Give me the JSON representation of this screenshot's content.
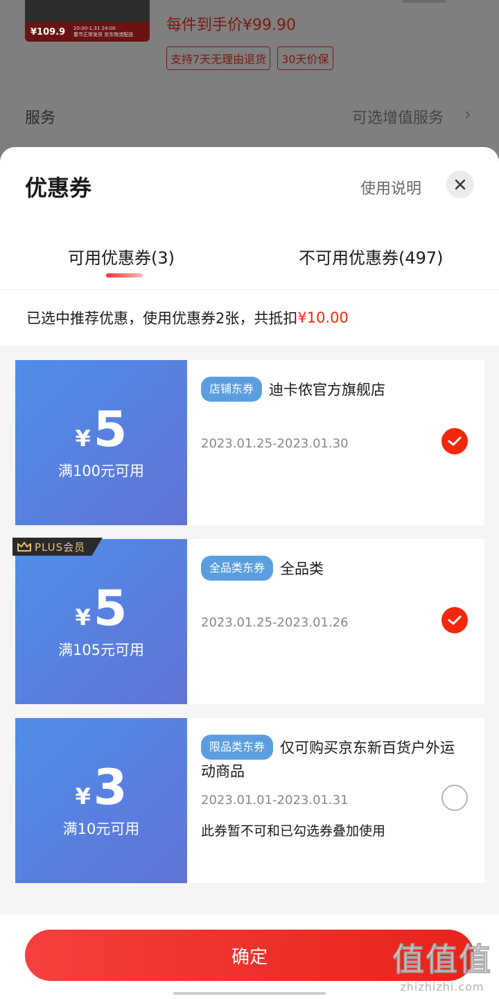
{
  "background": {
    "thumb_price": "¥109.9",
    "thumb_promo_time": "20:00-1.31 24:00",
    "thumb_promo_text": "春节正常发货 京东物流配送",
    "price_line": "每件到手价¥99.90",
    "tags": [
      "支持7天无理由退货",
      "30天价保"
    ],
    "service_label": "服务",
    "service_value": "可选增值服务",
    "service_arrow": "›"
  },
  "sheet": {
    "title": "优惠券",
    "usage_link": "使用说明",
    "tabs": [
      {
        "label": "可用优惠券(3)",
        "active": true
      },
      {
        "label": "不可用优惠券(497)",
        "active": false
      }
    ],
    "summary_text": "已选中推荐优惠，使用优惠券2张，共抵扣",
    "summary_amount": "¥10.00"
  },
  "coupons": [
    {
      "currency": "¥",
      "amount": "5",
      "condition": "满100元可用",
      "badge": "店铺东券",
      "title": "迪卡侬官方旗舰店",
      "date": "2023.01.25-2023.01.30",
      "note": "",
      "checked": true,
      "plus_label": ""
    },
    {
      "currency": "¥",
      "amount": "5",
      "condition": "满105元可用",
      "badge": "全品类东券",
      "title": "全品类",
      "date": "2023.01.25-2023.01.26",
      "note": "",
      "checked": true,
      "plus_label": "PLUS会员"
    },
    {
      "currency": "¥",
      "amount": "3",
      "condition": "满10元可用",
      "badge": "限品类东券",
      "title": "仅可购买京东新百货户外运动商品",
      "date": "2023.01.01-2023.01.31",
      "note": "此券暂不可和已勾选券叠加使用",
      "checked": false,
      "plus_label": ""
    }
  ],
  "footer": {
    "confirm_label": "确定"
  },
  "watermark": {
    "big": "值值值",
    "small": "zhizhizhi.com"
  },
  "colors": {
    "accent_red": "#f2270c",
    "coupon_blue_start": "#4f8ee8",
    "coupon_blue_end": "#6173d8",
    "badge_blue": "#5b9ee0"
  },
  "icons": {
    "close": "close-icon",
    "check": "checkmark-icon",
    "crown": "crown-icon",
    "arrow": "chevron-right-icon"
  }
}
